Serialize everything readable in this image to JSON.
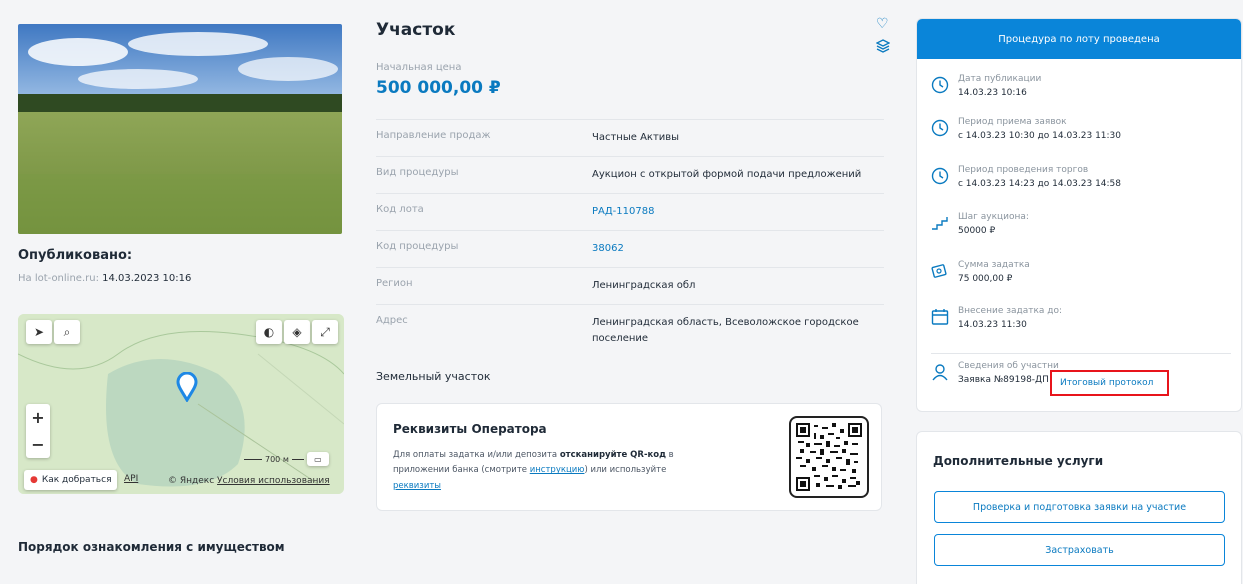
{
  "published": {
    "heading": "Опубликовано:",
    "site_label": "На lot-online.ru:",
    "date": "14.03.2023 10:16"
  },
  "map": {
    "route_label": "Как добраться",
    "api_label": "API",
    "copyright": "© Яндекс",
    "terms": "Условия использования",
    "scale": "700 м"
  },
  "bottom_section": "Порядок ознакомления с имуществом",
  "lot": {
    "title": "Участок",
    "price_label": "Начальная цена",
    "price": "500 000,00 ₽"
  },
  "info": [
    {
      "key": "Направление продаж",
      "value": "Частные Активы"
    },
    {
      "key": "Вид процедуры",
      "value": "Аукцион с открытой формой подачи предложений"
    },
    {
      "key": "Код лота",
      "value": "РАД-110788"
    },
    {
      "key": "Код процедуры",
      "value": "38062"
    },
    {
      "key": "Регион",
      "value": "Ленинградская обл"
    },
    {
      "key": "Адрес",
      "value": "Ленинградская область, Всеволожское городское поселение"
    }
  ],
  "category": "Земельный участок",
  "requisites": {
    "title": "Реквизиты Оператора",
    "text_1": "Для оплаты задатка и/или депозита ",
    "text_bold": "отсканируйте QR-код",
    "text_2": " в приложении банка (смотрите ",
    "link_instruction": "инструкцию",
    "text_3": ") или используйте",
    "link_requisites": "реквизиты"
  },
  "status": {
    "header": "Процедура по лоту проведена",
    "items": [
      {
        "label": "Дата публикации",
        "value": "14.03.23 10:16",
        "icon": "clock-icon"
      },
      {
        "label": "Период приема заявок",
        "value": "с 14.03.23 10:30 до 14.03.23 11:30",
        "icon": "clock-icon"
      },
      {
        "label": "Период проведения торгов",
        "value": "с 14.03.23 14:23 до 14.03.23 14:58",
        "icon": "clock-icon"
      },
      {
        "label": "Шаг аукциона:",
        "value": "50000 ₽",
        "icon": "steps-icon"
      },
      {
        "label": "Сумма задатка",
        "value": "75 000,00 ₽",
        "icon": "money-icon"
      },
      {
        "label": "Внесение задатка до:",
        "value": "14.03.23 11:30",
        "icon": "calendar-icon"
      }
    ],
    "participant_label": "Сведения об участни",
    "participant_value": "Заявка №89198-ДП",
    "protocol_link": "Итоговый протокол"
  },
  "services": {
    "title": "Дополнительные услуги",
    "check_button": "Проверка и подготовка заявки на участие",
    "insure_button": "Застраховать"
  },
  "colors": {
    "accent": "#0a85d9",
    "link": "#0a7ac0",
    "highlight": "#e8141b"
  }
}
